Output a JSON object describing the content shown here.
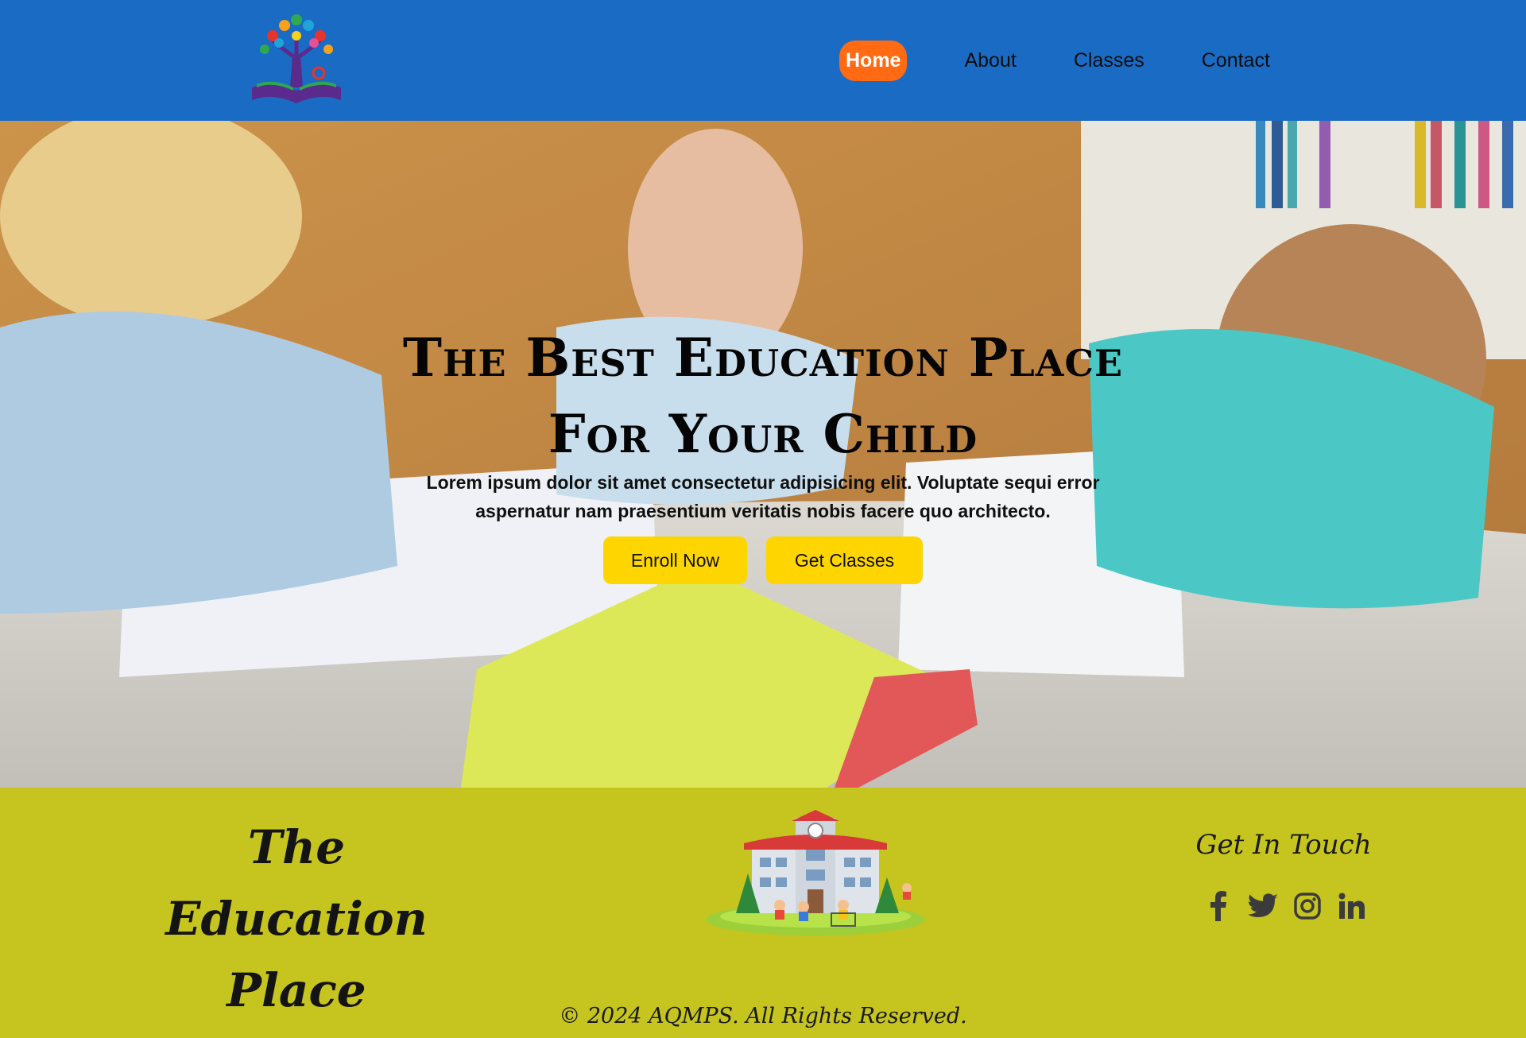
{
  "header": {
    "logo_alt": "tree-book-logo",
    "nav": [
      {
        "label": "Home",
        "active": true
      },
      {
        "label": "About",
        "active": false
      },
      {
        "label": "Classes",
        "active": false
      },
      {
        "label": "Contact",
        "active": false
      }
    ]
  },
  "hero": {
    "title_line1": "The Best Education Place",
    "title_line2": "For Your Child",
    "subtitle_line1": "Lorem ipsum dolor sit amet consectetur adipisicing elit. Voluptate sequi error",
    "subtitle_line2": "aspernatur nam praesentium veritatis nobis facere quo architecto.",
    "buttons": {
      "enroll": "Enroll Now",
      "classes": "Get Classes"
    }
  },
  "footer": {
    "brand_line1": "The Education",
    "brand_line2": "Place",
    "touch_title": "Get In Touch",
    "socials": [
      "facebook-icon",
      "twitter-icon",
      "instagram-icon",
      "linkedin-icon"
    ],
    "copyright": "© 2024 AQMPS. All Rights Reserved."
  },
  "colors": {
    "header_bg": "#1a6bc4",
    "active_nav": "#ff6a13",
    "button": "#ffd500",
    "footer_bg": "#c6c41f"
  }
}
